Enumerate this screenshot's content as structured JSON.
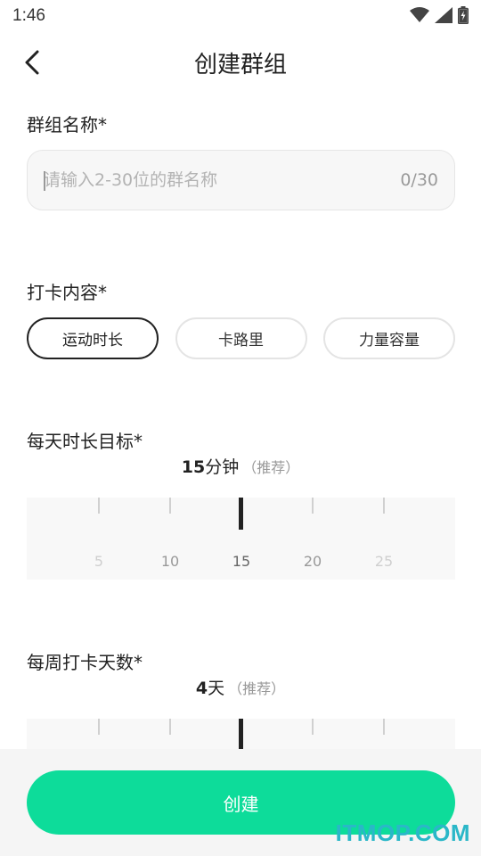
{
  "status_bar": {
    "time": "1:46"
  },
  "nav": {
    "title": "创建群组",
    "back_icon": "chevron-left-icon"
  },
  "group_name": {
    "label": "群组名称*",
    "value": "",
    "placeholder": "请输入2-30位的群名称",
    "count": "0/30"
  },
  "checkin_content": {
    "label": "打卡内容*",
    "options": [
      "运动时长",
      "卡路里",
      "力量容量"
    ],
    "selected": "运动时长"
  },
  "daily_goal": {
    "label": "每天时长目标*",
    "value": "15",
    "unit": "分钟",
    "recommend": "（推荐）",
    "ticks": [
      "5",
      "10",
      "15",
      "20",
      "25"
    ]
  },
  "weekly_days": {
    "label": "每周打卡天数*",
    "value": "4",
    "unit": "天",
    "recommend": "（推荐）"
  },
  "footer": {
    "create_label": "创建",
    "watermark": "ITMOP.COM"
  },
  "colors": {
    "accent": "#0ddc9a",
    "watermark": "#2ab7c8"
  }
}
